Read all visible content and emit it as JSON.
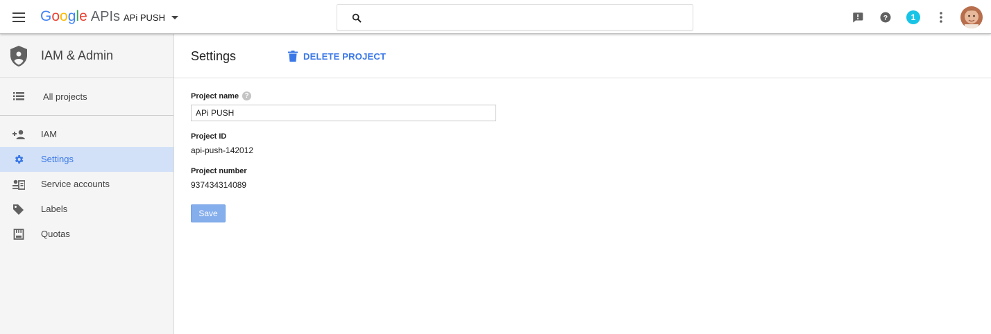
{
  "topbar": {
    "logo_google": "Google",
    "logo_apis": "APIs",
    "project_name": "APi PUSH",
    "search_placeholder": "",
    "notification_count": "1",
    "icons": [
      "menu-icon",
      "search-icon",
      "feedback-icon",
      "help-icon",
      "notification-badge",
      "more-vert-icon",
      "avatar"
    ]
  },
  "sidebar": {
    "title": "IAM & Admin",
    "all_projects": "All projects",
    "items": [
      {
        "label": "IAM",
        "icon": "person-add-icon",
        "active": false
      },
      {
        "label": "Settings",
        "icon": "gear-icon",
        "active": true
      },
      {
        "label": "Service accounts",
        "icon": "service-account-icon",
        "active": false
      },
      {
        "label": "Labels",
        "icon": "label-icon",
        "active": false
      },
      {
        "label": "Quotas",
        "icon": "quota-icon",
        "active": false
      }
    ]
  },
  "main": {
    "title": "Settings",
    "delete_label": "DELETE PROJECT",
    "project_name_label": "Project name",
    "project_name_value": "APi PUSH",
    "project_id_label": "Project ID",
    "project_id_value": "api-push-142012",
    "project_number_label": "Project number",
    "project_number_value": "937434314089",
    "save_label": "Save"
  },
  "colors": {
    "accent": "#3b78e7",
    "active_bg": "#d2e1f7",
    "badge": "#18c4e6",
    "save_button": "#85aeec"
  }
}
